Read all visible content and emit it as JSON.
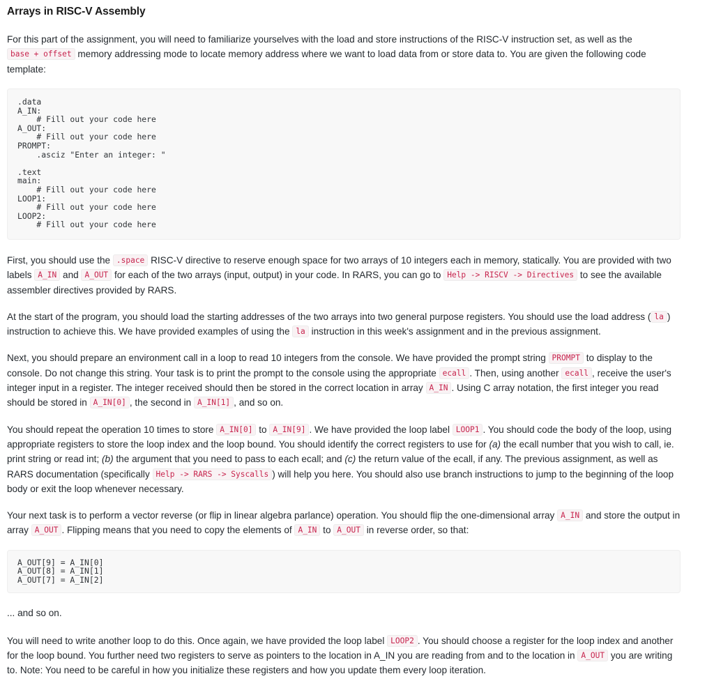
{
  "title": "Arrays in RISC-V Assembly",
  "paragraphs": {
    "intro_1": "For this part of the assignment, you will need to familiarize yourselves with the load and store instructions of the RISC-V instruction set, as well as the ",
    "intro_code_1": "base + offset",
    "intro_2": " memory addressing mode to locate memory address where we want to load data from or store data to. You are given the following code template:",
    "space_1": "First, you should use the ",
    "space_code_1": ".space",
    "space_2": " RISC-V directive to reserve enough space for two arrays of 10 integers each in memory, statically. You are provided with two labels ",
    "space_code_2": "A_IN",
    "space_3": " and ",
    "space_code_3": "A_OUT",
    "space_4": " for each of the two arrays (input, output) in your code. In RARS, you can go to ",
    "space_code_4": "Help -> RISCV -> Directives",
    "space_5": " to see the available assembler directives provided by RARS.",
    "la_1": "At the start of the program, you should load the starting addresses of the two arrays into two general purpose registers. You should use the load address (",
    "la_code_1": "la",
    "la_2": ") instruction to achieve this. We have provided examples of using the ",
    "la_code_2": "la",
    "la_3": " instruction in this week's assignment and in the previous assignment.",
    "ecall_1": "Next, you should prepare an environment call in a loop to read 10 integers from the console. We have provided the prompt string ",
    "ecall_code_1": "PROMPT",
    "ecall_2": " to display to the console. Do not change this string. Your task is to print the prompt to the console using the appropriate ",
    "ecall_code_2": "ecall",
    "ecall_3": ". Then, using another ",
    "ecall_code_3": "ecall",
    "ecall_4": ", receive the user's integer input in a register. The integer received should then be stored in the correct location in array ",
    "ecall_code_4": "A_IN",
    "ecall_5": ". Using C array notation, the first integer you read should be stored in ",
    "ecall_code_5": "A_IN[0]",
    "ecall_6": ", the second in ",
    "ecall_code_6": "A_IN[1]",
    "ecall_7": ", and so on.",
    "loop1_1": "You should repeat the operation 10 times to store ",
    "loop1_code_1": "A_IN[0]",
    "loop1_2": " to ",
    "loop1_code_2": "A_IN[9]",
    "loop1_3": ". We have provided the loop label ",
    "loop1_code_3": "LOOP1",
    "loop1_4": ". You should code the body of the loop, using appropriate registers to store the loop index and the loop bound. You should identify the correct registers to use for ",
    "loop1_em_a": "(a)",
    "loop1_5": " the ecall number that you wish to call, ie. print string or read int; ",
    "loop1_em_b": "(b)",
    "loop1_6": " the argument that you need to pass to each ecall; and ",
    "loop1_em_c": "(c)",
    "loop1_7": " the return value of the ecall, if any. The previous assignment, as well as RARS documentation (specifically ",
    "loop1_code_4": "Help -> RARS -> Syscalls",
    "loop1_8": ") will help you here. You should also use branch instructions to jump to the beginning of the loop body or exit the loop whenever necessary.",
    "flip_1": "Your next task is to perform a vector reverse (or flip in linear algebra parlance) operation. You should flip the one-dimensional array ",
    "flip_code_1": "A_IN",
    "flip_2": " and store the output in array ",
    "flip_code_2": "A_OUT",
    "flip_3": ". Flipping means that you need to copy the elements of ",
    "flip_code_3": "A_IN",
    "flip_4": " to ",
    "flip_code_4": "A_OUT",
    "flip_5": " in reverse order, so that:",
    "and_so_on": "... and so on.",
    "loop2_1": "You will need to write another loop to do this. Once again, we have provided the loop label ",
    "loop2_code_1": "LOOP2",
    "loop2_2": ". You should choose a register for the loop index and another for the loop bound. You further need two registers to serve as pointers to the location in A_IN you are reading from and to the location in ",
    "loop2_code_2": "A_OUT",
    "loop2_3": " you are writing to. Note: You need to be careful in how you initialize these registers and how you update them every loop iteration."
  },
  "code_template": ".data\nA_IN:\n    # Fill out your code here\nA_OUT:\n    # Fill out your code here\nPROMPT:\n    .asciz \"Enter an integer: \"\n\n.text\nmain:\n    # Fill out your code here\nLOOP1:\n    # Fill out your code here\nLOOP2:\n    # Fill out your code here",
  "code_flip_example": "A_OUT[9] = A_IN[0]\nA_OUT[8] = A_IN[1]\nA_OUT[7] = A_IN[2]",
  "colors": {
    "inline_code_text": "#c7254e",
    "inline_code_bg": "#f9f2f4",
    "code_block_bg": "#f8f8f8",
    "code_block_border": "#eeeeee",
    "body_text": "#24292e",
    "title_text": "#1a1a1a"
  }
}
